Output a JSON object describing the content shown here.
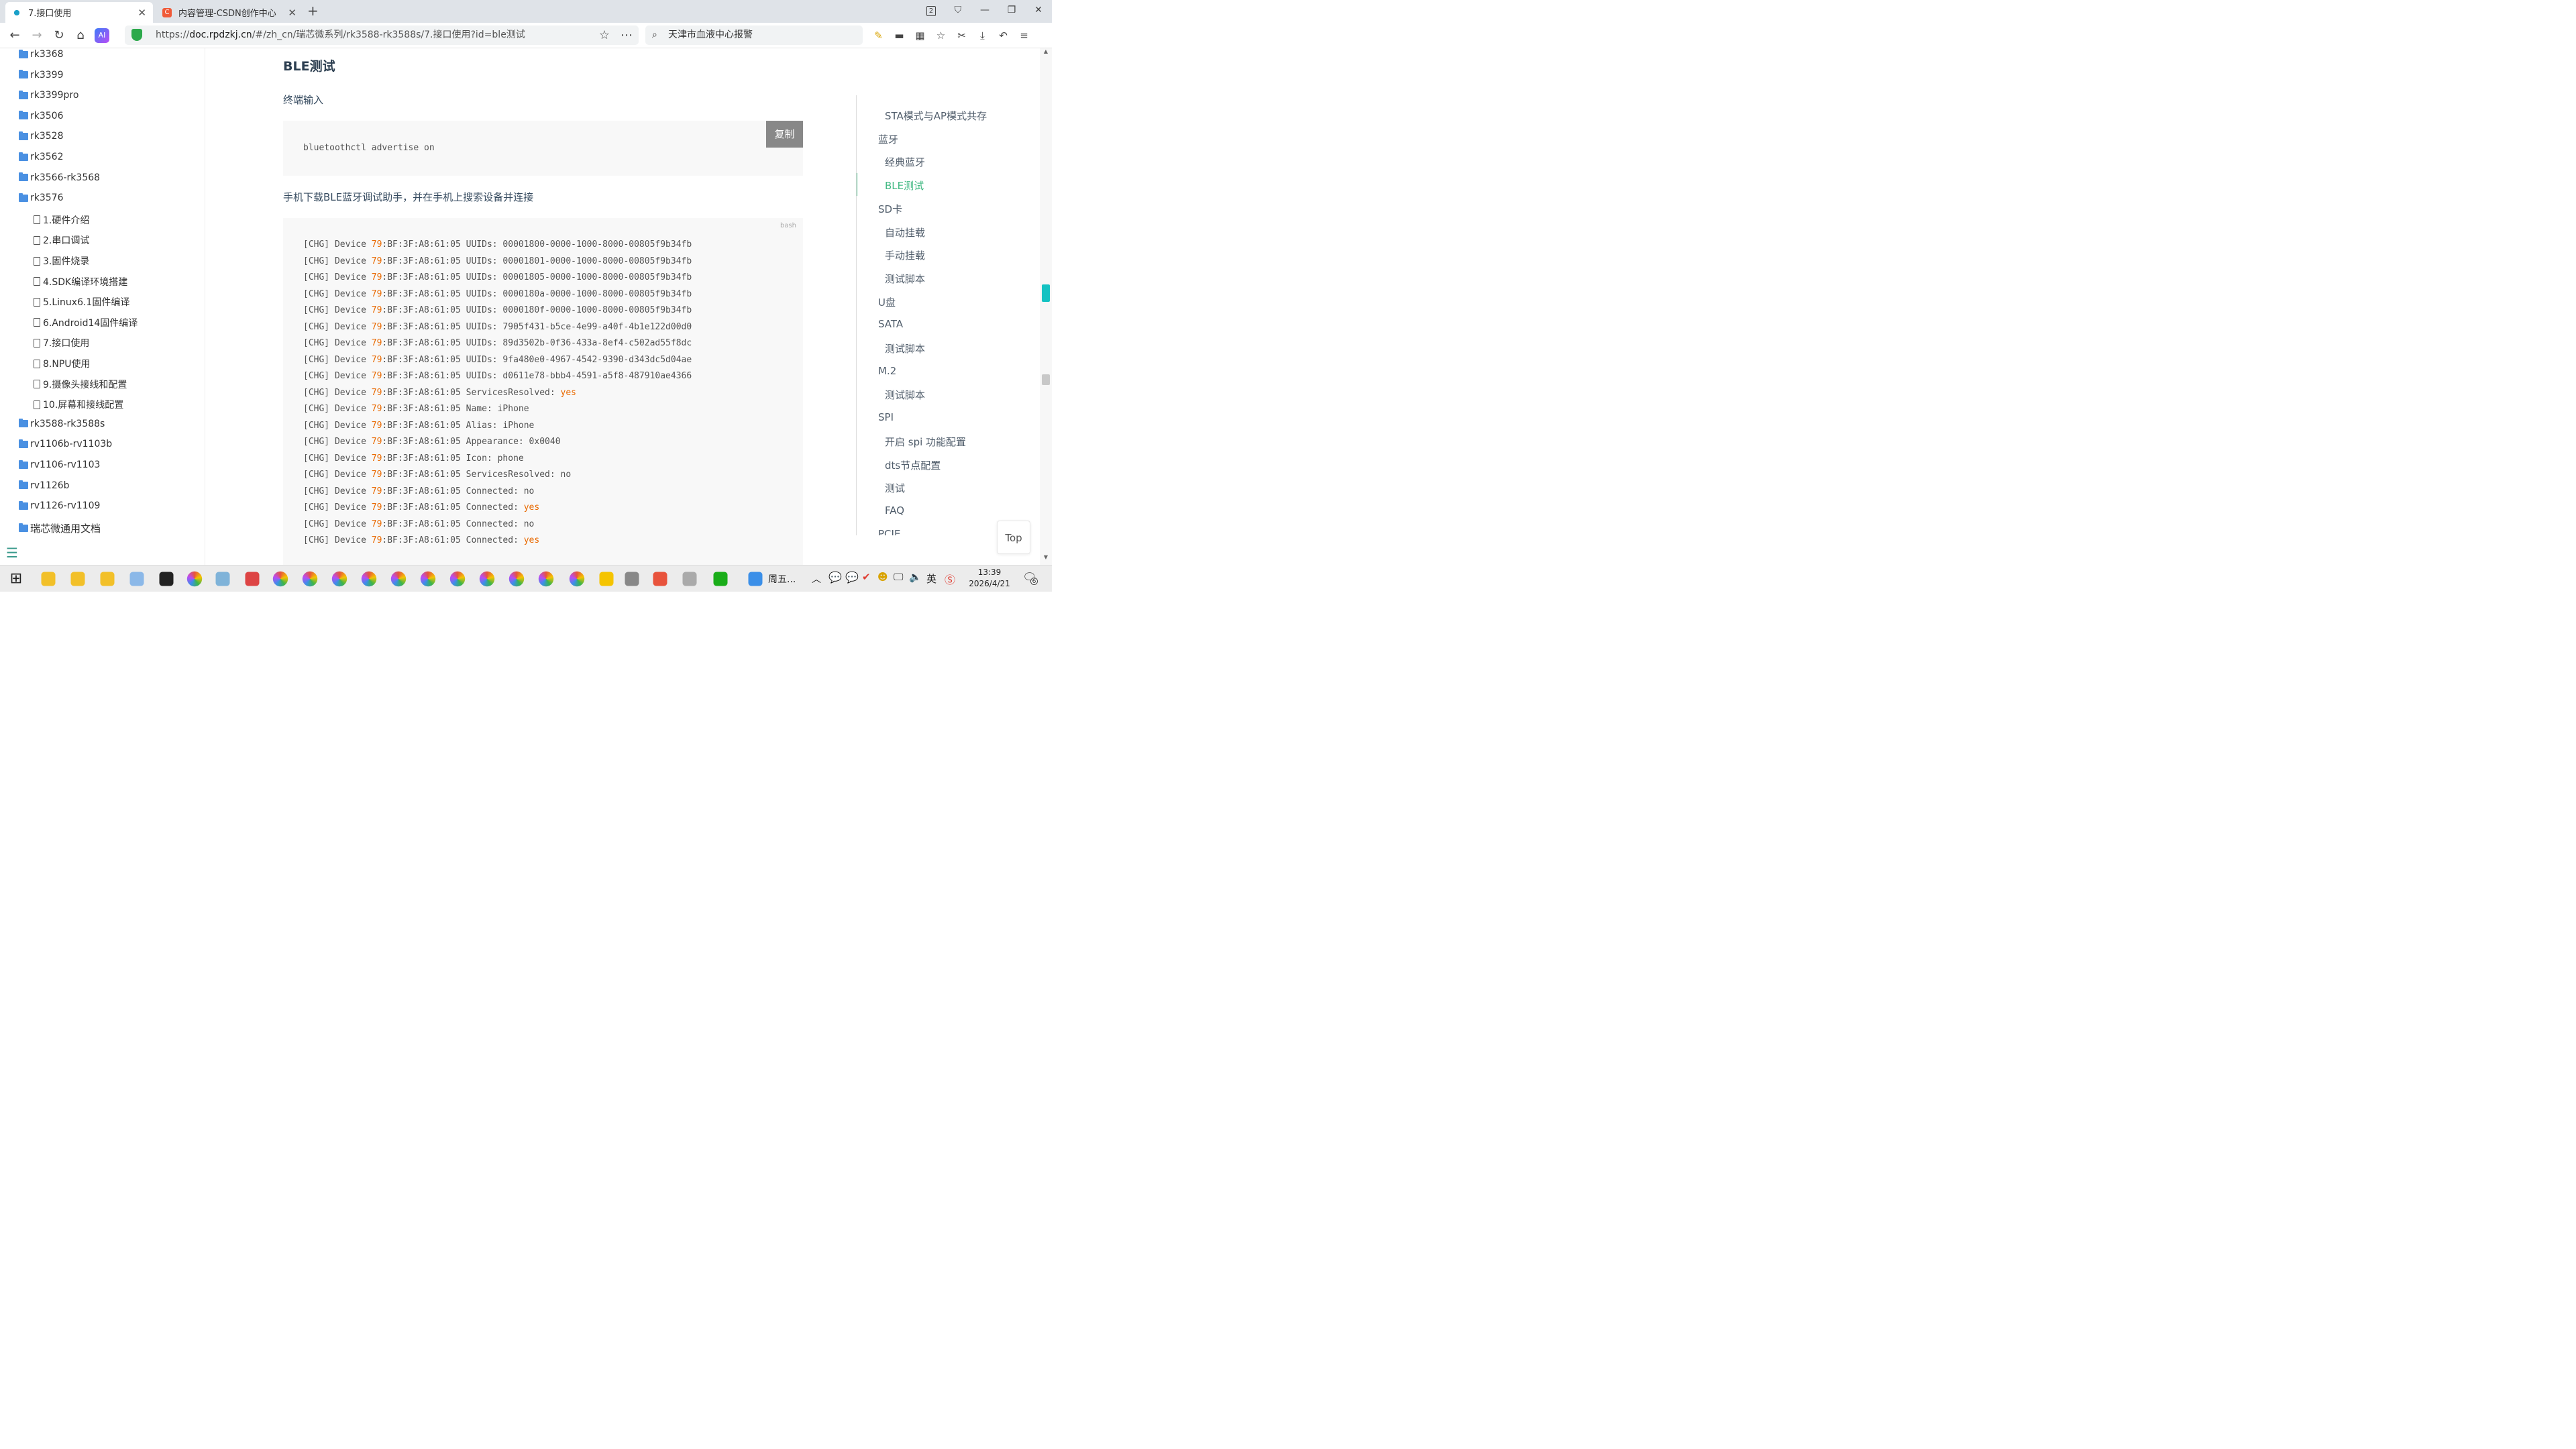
{
  "browser": {
    "tabs": [
      {
        "title": "7.接口使用",
        "active": true
      },
      {
        "title": "内容管理-CSDN创作中心",
        "active": false
      }
    ],
    "new_tab": "+",
    "window_badge": "2",
    "address_prefix": "https://",
    "address_domain": "doc.rpdzkj.cn",
    "address_path": "/#/zh_cn/瑞芯微系列/rk3588-rk3588s/7.接口使用?id=ble测试",
    "search_text": "天津市血液中心报警"
  },
  "sidebar": {
    "folders_top": [
      "rk3368",
      "rk3399",
      "rk3399pro",
      "rk3506",
      "rk3528",
      "rk3562",
      "rk3566-rk3568",
      "rk3576"
    ],
    "docs": [
      "1.硬件介绍",
      "2.串口调试",
      "3.固件烧录",
      "4.SDK编译环境搭建",
      "5.Linux6.1固件编译",
      "6.Android14固件编译",
      "7.接口使用",
      "8.NPU使用",
      "9.摄像头接线和配置",
      "10.屏幕和接线配置"
    ],
    "folders_bottom": [
      "rk3588-rk3588s",
      "rv1106b-rv1103b",
      "rv1106-rv1103",
      "rv1126b",
      "rv1126-rv1109"
    ],
    "general_folder": "瑞芯微通用文档"
  },
  "content": {
    "heading": "BLE测试",
    "terminal_label": "终端输入",
    "command": "bluetoothctl advertise on",
    "copy_label": "复制",
    "phone_instruction": "手机下载BLE蓝牙调试助手，并在手机上搜索设备并连接",
    "bash_label": "bash",
    "log_prefix": "[CHG] Device ",
    "device_id": "79",
    "device_rest": ":BF:3F:A8:61:05 ",
    "log_lines": [
      {
        "msg": "UUIDs: 00001800-0000-1000-8000-00805f9b34fb",
        "kw": ""
      },
      {
        "msg": "UUIDs: 00001801-0000-1000-8000-00805f9b34fb",
        "kw": ""
      },
      {
        "msg": "UUIDs: 00001805-0000-1000-8000-00805f9b34fb",
        "kw": ""
      },
      {
        "msg": "UUIDs: 0000180a-0000-1000-8000-00805f9b34fb",
        "kw": ""
      },
      {
        "msg": "UUIDs: 0000180f-0000-1000-8000-00805f9b34fb",
        "kw": ""
      },
      {
        "msg": "UUIDs: 7905f431-b5ce-4e99-a40f-4b1e122d00d0",
        "kw": ""
      },
      {
        "msg": "UUIDs: 89d3502b-0f36-433a-8ef4-c502ad55f8dc",
        "kw": ""
      },
      {
        "msg": "UUIDs: 9fa480e0-4967-4542-9390-d343dc5d04ae",
        "kw": ""
      },
      {
        "msg": "UUIDs: d0611e78-bbb4-4591-a5f8-487910ae4366",
        "kw": ""
      },
      {
        "msg": "ServicesResolved: ",
        "kw": "yes"
      },
      {
        "msg": "Name: iPhone",
        "kw": ""
      },
      {
        "msg": "Alias: iPhone",
        "kw": ""
      },
      {
        "msg": "Appearance: 0x0040",
        "kw": ""
      },
      {
        "msg": "Icon: phone",
        "kw": ""
      },
      {
        "msg": "ServicesResolved: no",
        "kw": ""
      },
      {
        "msg": "Connected: no",
        "kw": ""
      },
      {
        "msg": "Connected: ",
        "kw": "yes"
      },
      {
        "msg": "Connected: no",
        "kw": ""
      },
      {
        "msg": "Connected: ",
        "kw": "yes"
      }
    ]
  },
  "toc": {
    "items": [
      {
        "label": "STA模式与AP模式共存",
        "level": 2,
        "active": false
      },
      {
        "label": "蓝牙",
        "level": 1,
        "active": false
      },
      {
        "label": "经典蓝牙",
        "level": 2,
        "active": false
      },
      {
        "label": "BLE测试",
        "level": 2,
        "active": true
      },
      {
        "label": "SD卡",
        "level": 1,
        "active": false
      },
      {
        "label": "自动挂载",
        "level": 2,
        "active": false
      },
      {
        "label": "手动挂载",
        "level": 2,
        "active": false
      },
      {
        "label": "测试脚本",
        "level": 2,
        "active": false
      },
      {
        "label": "U盘",
        "level": 1,
        "active": false
      },
      {
        "label": "SATA",
        "level": 1,
        "active": false
      },
      {
        "label": "测试脚本",
        "level": 2,
        "active": false
      },
      {
        "label": "M.2",
        "level": 1,
        "active": false
      },
      {
        "label": "测试脚本",
        "level": 2,
        "active": false
      },
      {
        "label": "SPI",
        "level": 1,
        "active": false
      },
      {
        "label": "开启 spi 功能配置",
        "level": 2,
        "active": false
      },
      {
        "label": "dts节点配置",
        "level": 2,
        "active": false
      },
      {
        "label": "测试",
        "level": 2,
        "active": false
      },
      {
        "label": "FAQ",
        "level": 2,
        "active": false
      },
      {
        "label": "PCIE",
        "level": 1,
        "active": false
      }
    ],
    "top_label": "Top"
  },
  "taskbar": {
    "weather_text": "周五...",
    "time": "13:39",
    "date": "2026/4/21",
    "ime": "英",
    "notification_count": "6"
  },
  "colors": {
    "accent": "#42b983",
    "keyword": "#e96900",
    "folder": "#4a90e2",
    "heading": "#2c3e50"
  }
}
